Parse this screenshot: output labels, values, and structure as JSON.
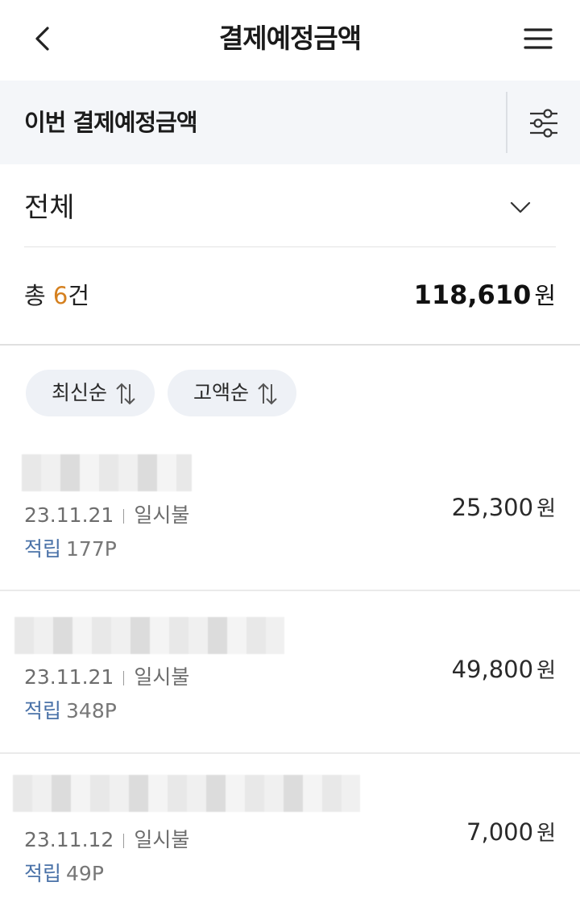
{
  "header": {
    "title": "결제예정금액",
    "back_icon": "chevron-left-icon",
    "menu_icon": "hamburger-menu-icon"
  },
  "subbar": {
    "title": "이번 결제예정금액",
    "filter_icon": "sliders-icon"
  },
  "filter": {
    "selected": "전체",
    "chevron_icon": "chevron-down-icon"
  },
  "summary": {
    "count_prefix": "총 ",
    "count": "6",
    "count_suffix": "건",
    "total": "118,610",
    "total_unit": "원",
    "accent_color": "#d5801f"
  },
  "sort": {
    "latest_label": "최신순",
    "amount_label": "고액순",
    "sort_icon": "sort-arrows-icon"
  },
  "transactions": [
    {
      "date": "23.11.21",
      "type": "일시불",
      "points_label": "적립",
      "points": "177P",
      "amount": "25,300",
      "unit": "원"
    },
    {
      "date": "23.11.21",
      "type": "일시불",
      "points_label": "적립",
      "points": "348P",
      "amount": "49,800",
      "unit": "원"
    },
    {
      "date": "23.11.12",
      "type": "일시불",
      "points_label": "적립",
      "points": "49P",
      "amount": "7,000",
      "unit": "원"
    }
  ]
}
